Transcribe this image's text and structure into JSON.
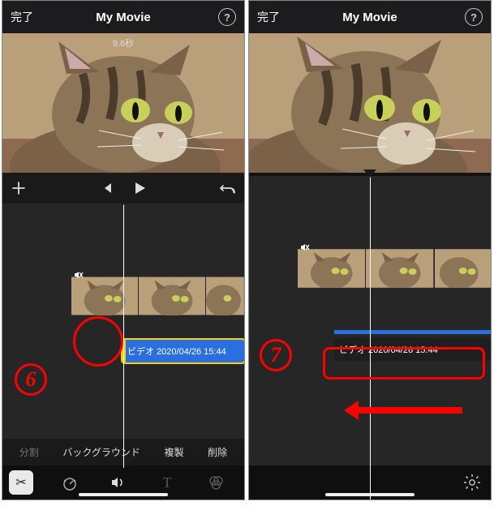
{
  "header": {
    "done_label": "完了",
    "title": "My Movie",
    "help_label": "?"
  },
  "preview": {
    "duration_label": "9.6秒"
  },
  "timeline": {
    "audio_clip_label": "ビデオ 2020/04/26 15:44"
  },
  "edit_toolbar": {
    "split": "分割",
    "background": "バックグラウンド",
    "duplicate": "複製",
    "delete": "削除"
  },
  "annotations": {
    "step6": "6",
    "step7": "7"
  }
}
